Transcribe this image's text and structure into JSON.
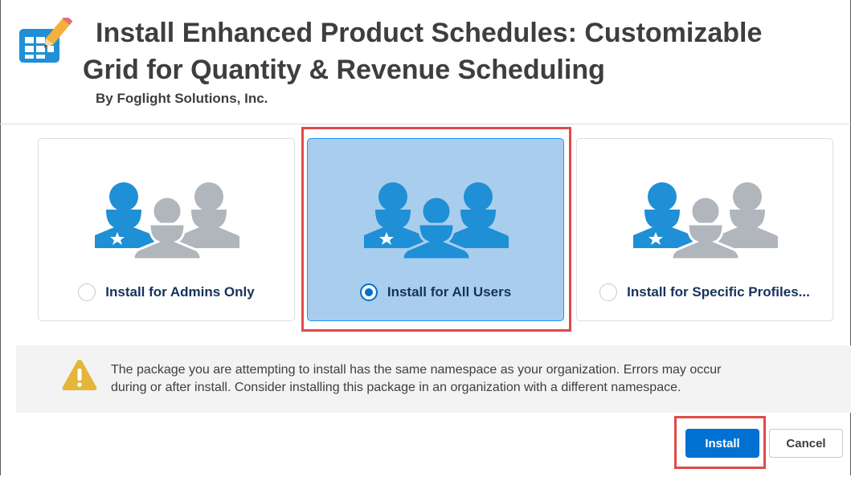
{
  "header": {
    "title_line1": "Install Enhanced Product Schedules: Customizable",
    "title_line2": "Grid for Quantity & Revenue Scheduling",
    "publisher": "By Foglight Solutions, Inc.",
    "icon": "grid-edit-icon"
  },
  "options": [
    {
      "label": "Install for Admins Only",
      "selected": false,
      "icon": "users-group-icon"
    },
    {
      "label": "Install for All Users",
      "selected": true,
      "icon": "users-group-icon"
    },
    {
      "label": "Install for Specific Profiles...",
      "selected": false,
      "icon": "users-group-icon"
    }
  ],
  "warning": {
    "icon": "warning-icon",
    "line1": "The package you are attempting to install has the same namespace as your organization. Errors may occur",
    "line2": "during or after install. Consider installing this package in an organization with a different namespace."
  },
  "buttons": {
    "install_label": "Install",
    "cancel_label": "Cancel"
  },
  "colors": {
    "accent": "#0070d2",
    "selected_card": "#a9cdec",
    "highlight": "#e04a4a",
    "user_blue": "#1f8fd6",
    "user_gray": "#b0b6bb",
    "warning_yellow": "#e4b53a"
  }
}
